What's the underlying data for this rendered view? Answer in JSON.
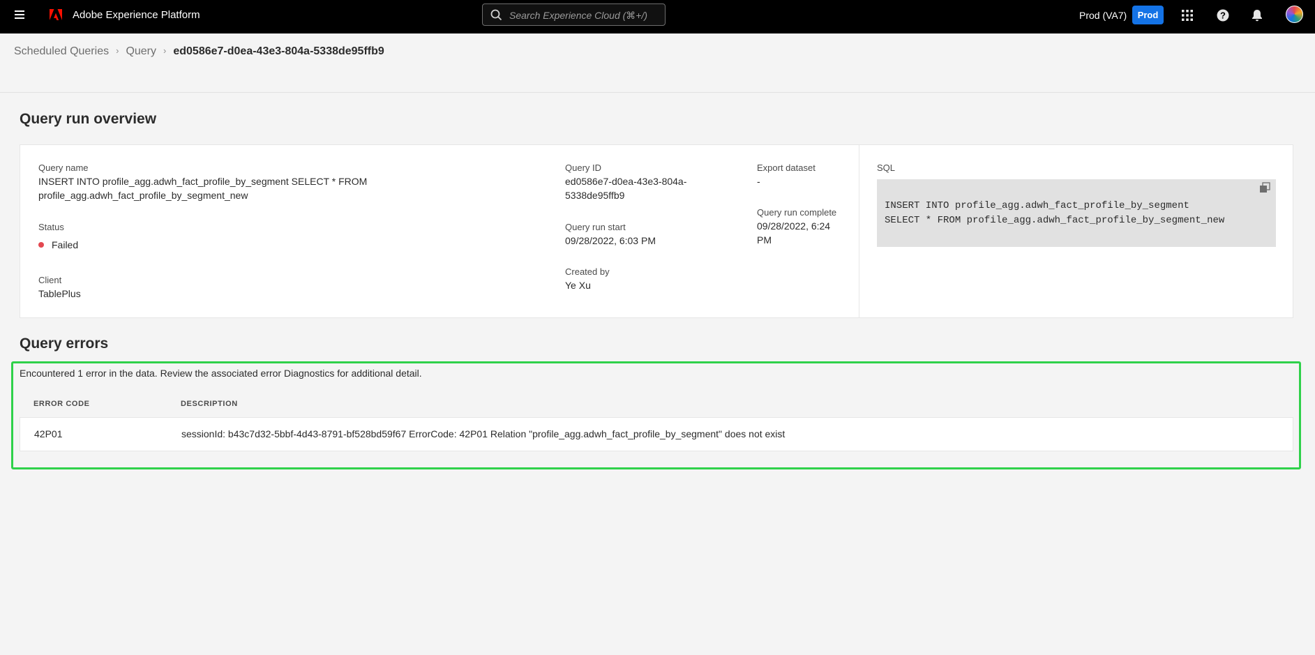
{
  "header": {
    "app_title": "Adobe Experience Platform",
    "search_placeholder": "Search Experience Cloud (⌘+/)",
    "org_name": "Prod (VA7)",
    "env_label": "Prod"
  },
  "breadcrumb": {
    "items": [
      "Scheduled Queries",
      "Query"
    ],
    "current": "ed0586e7-d0ea-43e3-804a-5338de95ffb9"
  },
  "overview": {
    "title": "Query run overview",
    "query_name_label": "Query name",
    "query_name_line1": "INSERT INTO profile_agg.adwh_fact_profile_by_segment SELECT * FROM",
    "query_name_line2": "profile_agg.adwh_fact_profile_by_segment_new",
    "status_label": "Status",
    "status_value": "Failed",
    "client_label": "Client",
    "client_value": "TablePlus",
    "query_id_label": "Query ID",
    "query_id_line1": "ed0586e7-d0ea-43e3-804a-",
    "query_id_line2": "5338de95ffb9",
    "run_start_label": "Query run start",
    "run_start_value": "09/28/2022, 6:03 PM",
    "created_by_label": "Created by",
    "created_by_value": "Ye Xu",
    "export_dataset_label": "Export dataset",
    "export_dataset_value": "-",
    "run_complete_label": "Query run complete",
    "run_complete_line1": "09/28/2022, 6:24",
    "run_complete_line2": "PM",
    "sql_label": "SQL",
    "sql_line1": "INSERT INTO profile_agg.adwh_fact_profile_by_segment",
    "sql_line2": "SELECT * FROM profile_agg.adwh_fact_profile_by_segment_new"
  },
  "errors": {
    "title": "Query errors",
    "summary": "Encountered 1 error in the data. Review the associated error Diagnostics for additional detail.",
    "columns": [
      "ERROR CODE",
      "DESCRIPTION"
    ],
    "rows": [
      {
        "code": "42P01",
        "description": "sessionId: b43c7d32-5bbf-4d43-8791-bf528bd59f67 ErrorCode: 42P01 Relation \"profile_agg.adwh_fact_profile_by_segment\" does not exist"
      }
    ]
  },
  "colors": {
    "accent": "#1473e6",
    "failed": "#e34850",
    "highlight": "#2fd14a",
    "brand": "#fa0f00"
  },
  "icons": [
    "menu-icon",
    "adobe-logo-icon",
    "search-icon",
    "apps-grid-icon",
    "help-icon",
    "notification-bell-icon",
    "avatar",
    "copy-icon",
    "chevron-right-icon"
  ]
}
